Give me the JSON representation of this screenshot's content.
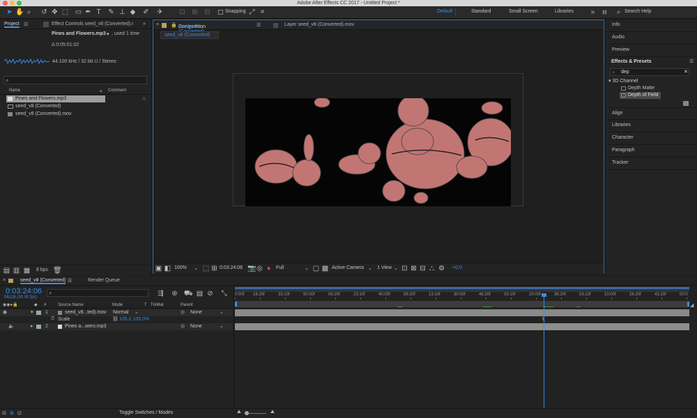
{
  "app": {
    "title": "Adobe After Effects CC 2017 - Untitled Project *"
  },
  "toolbar": {
    "snapping_label": "Snapping",
    "workspaces": [
      "Default",
      "Standard",
      "Small Screen",
      "Libraries"
    ],
    "active_workspace": "Default",
    "search_help_placeholder": "Search Help"
  },
  "project": {
    "tab_label": "Project",
    "effect_controls_tab": "Effect Controls seed_v8 (Converted).r",
    "file_name": "Pines and Flowers.mp3",
    "file_used": ", used 1 time",
    "duration": "Δ 0:05:01:02",
    "audio_info": "44.100 kHz / 32 bit U / Stereo",
    "col_name": "Name",
    "col_comment": "Comment",
    "items": [
      "Pines and Flowers.mp3",
      "seed_v8 (Converted)",
      "seed_v8 (Converted).mov"
    ],
    "bpc": "8 bpc"
  },
  "composition": {
    "tab_prefix": "Composition",
    "tab_name": "seed_v8 (Converted)",
    "layer_tab": "Layer seed_v8 (Converted).mov",
    "breadcrumb": "seed_v8 (Converted)",
    "zoom": "100%",
    "timecode": "0:03:24:06",
    "resolution": "Full",
    "camera": "Active Camera",
    "views": "1 View",
    "exposure": "+0.0"
  },
  "right_panel": {
    "top_items": [
      "Info",
      "Audio",
      "Preview"
    ],
    "effects_title": "Effects & Presets",
    "search_value": "dep",
    "tree_folder": "3D Channel",
    "tree_items": [
      "Depth Matte",
      "Depth of Field"
    ],
    "bottom_items": [
      "Align",
      "Libraries",
      "Character",
      "Paragraph",
      "Tracker"
    ]
  },
  "timeline": {
    "tab_label": "seed_v8 (Converted)",
    "render_queue": "Render Queue",
    "timecode": "0:03:24:06",
    "frames": "06126 (30.00 fps)",
    "cols": {
      "num": "#",
      "source": "Source Name",
      "mode": "Mode",
      "t": "T",
      "trkmat": "TrkMat",
      "parent": "Parent"
    },
    "layers": [
      {
        "num": "1",
        "name": "seed_v8...ted).mov",
        "mode": "Normal",
        "parent": "None"
      },
      {
        "num": "2",
        "name": "Pines a...wers.mp3",
        "mode": "",
        "parent": "None"
      }
    ],
    "scale_label": "Scale",
    "scale_value": "105.0,105.0%",
    "ruler_ticks": [
      "0:00f",
      "16:20f",
      "33:10f",
      "50:00f",
      "06:20f",
      "23:10f",
      "40:00f",
      "56:20f",
      "13:10f",
      "30:00f",
      "46:20f",
      "03:10f",
      "20:00f",
      "36:20f",
      "53:10f",
      "10:00f",
      "26:20f",
      "43:10f",
      "00:0"
    ],
    "footer": "Toggle Switches / Modes"
  }
}
